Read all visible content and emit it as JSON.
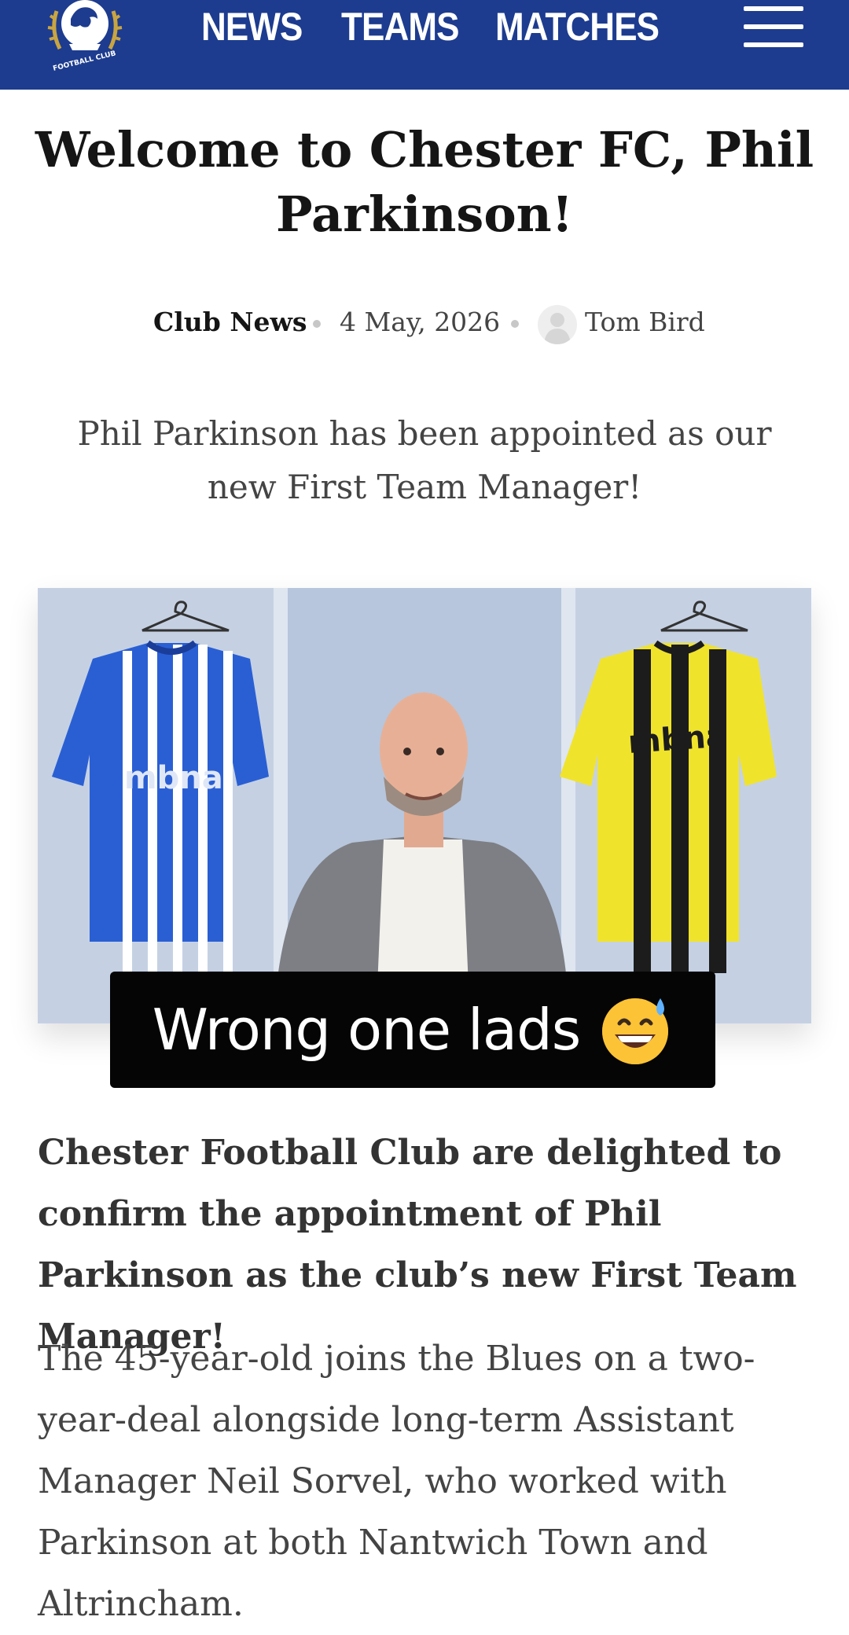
{
  "header": {
    "nav": [
      "NEWS",
      "TEAMS",
      "MATCHES"
    ],
    "crest_text": "FOOTBALL CLUB",
    "menu_icon": "hamburger-menu-icon",
    "background_color": "#1d3c8f"
  },
  "article": {
    "title": "Welcome to Chester FC, Phil Parkinson!",
    "category": "Club News",
    "date": "4 May, 2026",
    "author": "Tom Bird",
    "lead": "Phil Parkinson has been appointed as our new First Team Manager!",
    "image_caption_overlay": "Wrong one lads",
    "image_caption_emoji": "grinning-sweat-emoji",
    "standfirst": "Chester Football Club are delighted to confirm the appointment of Phil Parkinson as the club’s new First Team Manager!",
    "body": "The 45-year-old joins the Blues on a two-year-deal alongside long-term Assistant Manager Neil Sorvel, who worked with Parkinson at both Nantwich Town and Altrincham."
  },
  "photo": {
    "home_shirt_sponsor": "mbna",
    "away_shirt_sponsor": "mbna"
  }
}
